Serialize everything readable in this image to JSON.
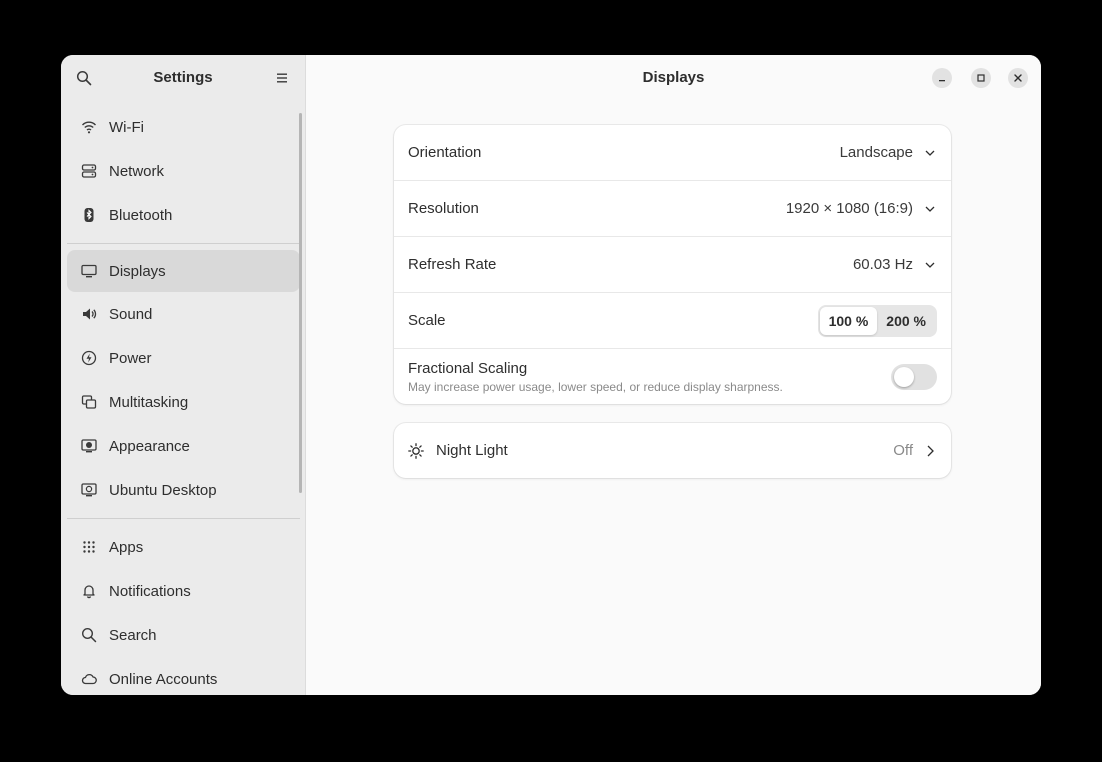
{
  "sidebar": {
    "title": "Settings",
    "search_icon": "search-icon",
    "menu_icon": "hamburger-menu-icon",
    "groups": [
      [
        {
          "label": "Wi-Fi",
          "icon": "wifi-icon"
        },
        {
          "label": "Network",
          "icon": "network-icon"
        },
        {
          "label": "Bluetooth",
          "icon": "bluetooth-icon"
        }
      ],
      [
        {
          "label": "Displays",
          "icon": "display-icon",
          "active": true
        },
        {
          "label": "Sound",
          "icon": "speaker-icon"
        },
        {
          "label": "Power",
          "icon": "power-icon"
        },
        {
          "label": "Multitasking",
          "icon": "multitasking-icon"
        },
        {
          "label": "Appearance",
          "icon": "appearance-icon"
        },
        {
          "label": "Ubuntu Desktop",
          "icon": "ubuntu-desktop-icon"
        }
      ],
      [
        {
          "label": "Apps",
          "icon": "apps-grid-icon"
        },
        {
          "label": "Notifications",
          "icon": "bell-icon"
        },
        {
          "label": "Search",
          "icon": "search-icon"
        },
        {
          "label": "Online Accounts",
          "icon": "cloud-icon"
        }
      ]
    ]
  },
  "main": {
    "title": "Displays",
    "settings": {
      "orientation": {
        "label": "Orientation",
        "value": "Landscape"
      },
      "resolution": {
        "label": "Resolution",
        "value": "1920 × 1080 (16:9)"
      },
      "refresh_rate": {
        "label": "Refresh Rate",
        "value": "60.03 Hz"
      },
      "scale": {
        "label": "Scale",
        "options": [
          "100 %",
          "200 %"
        ],
        "selected": "100 %"
      },
      "fractional_scaling": {
        "label": "Fractional Scaling",
        "description": "May increase power usage, lower speed, or reduce display sharpness.",
        "enabled": false
      }
    },
    "night_light": {
      "label": "Night Light",
      "value": "Off",
      "icon": "sun-icon"
    }
  },
  "window_controls": [
    "minimize-icon",
    "maximize-icon",
    "close-icon"
  ],
  "colors": {
    "background": "#000000",
    "sidebar": "#ebebeb",
    "content": "#fafafa",
    "card": "#ffffff",
    "active_item": "#d9d9d9"
  }
}
